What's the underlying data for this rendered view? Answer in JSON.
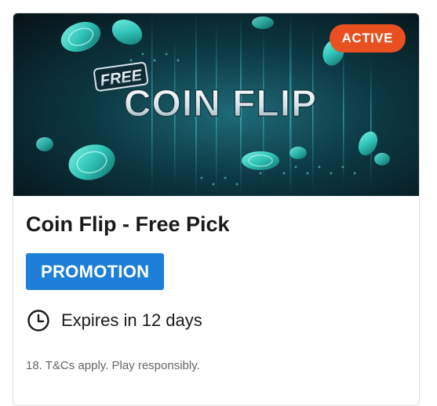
{
  "promotion_card": {
    "banner": {
      "badge_word": "FREE",
      "logo_text": "COIN FLIP",
      "status_badge": "ACTIVE"
    },
    "title": "Coin Flip - Free Pick",
    "category_tag": "PROMOTION",
    "expiry_text": "Expires in 12 days",
    "disclaimer": "18. T&Cs apply. Play responsibly.",
    "icons": {
      "expiry": "clock-icon",
      "coin": "coin-icon"
    },
    "colors": {
      "status_badge": "#e8501f",
      "category_tag": "#1e7fd8",
      "banner_background": "#0a2630",
      "coin_teal": "#2fc3b8",
      "coin_gold": "#e7b12f"
    }
  }
}
